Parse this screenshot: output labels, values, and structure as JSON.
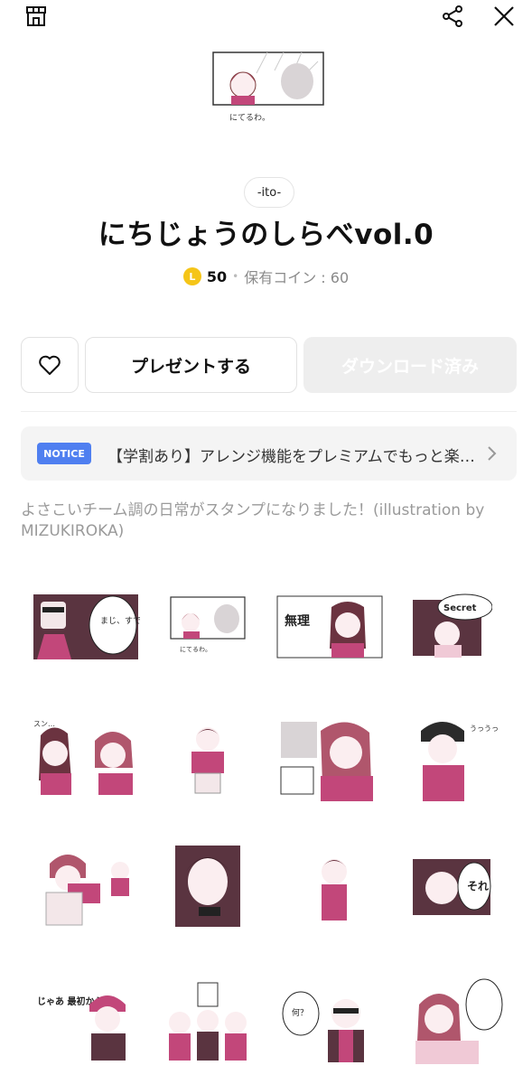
{
  "header": {
    "shop_icon": "shop-icon",
    "share_icon": "share-icon",
    "close_icon": "close-icon"
  },
  "product": {
    "author": "-ito-",
    "title": "にちじょうのしらべvol.0",
    "coin_symbol": "L",
    "price": "50",
    "separator": "•",
    "owned_coins": "保有コイン : 60",
    "main_sticker_caption": "にてるわ。"
  },
  "actions": {
    "favorite_icon": "heart-icon",
    "present_label": "プレゼントする",
    "download_label": "ダウンロード済み"
  },
  "notice": {
    "badge": "NOTICE",
    "text": "【学割あり】アレンジ機能をプレミアムでもっと楽しもう"
  },
  "description": "よさこいチーム調の日常がスタンプになりました！(illustration by MIZUKIROKA)",
  "stickers": [
    {
      "caption": "まじ、すでよんすか(？)"
    },
    {
      "caption": "にてるわ。"
    },
    {
      "caption": "無理"
    },
    {
      "caption": "Secret"
    },
    {
      "caption": "スン…"
    },
    {
      "caption": ""
    },
    {
      "caption": ""
    },
    {
      "caption": "うっうっ"
    },
    {
      "caption": ""
    },
    {
      "caption": ""
    },
    {
      "caption": ""
    },
    {
      "caption": "それ"
    },
    {
      "caption": "じゃあ 最初から"
    },
    {
      "caption": ""
    },
    {
      "caption": "何？"
    },
    {
      "caption": ""
    }
  ],
  "colors": {
    "accent_pink": "#c2477a",
    "notice_blue": "#4f7ff0",
    "coin_gold": "#f5c518"
  }
}
